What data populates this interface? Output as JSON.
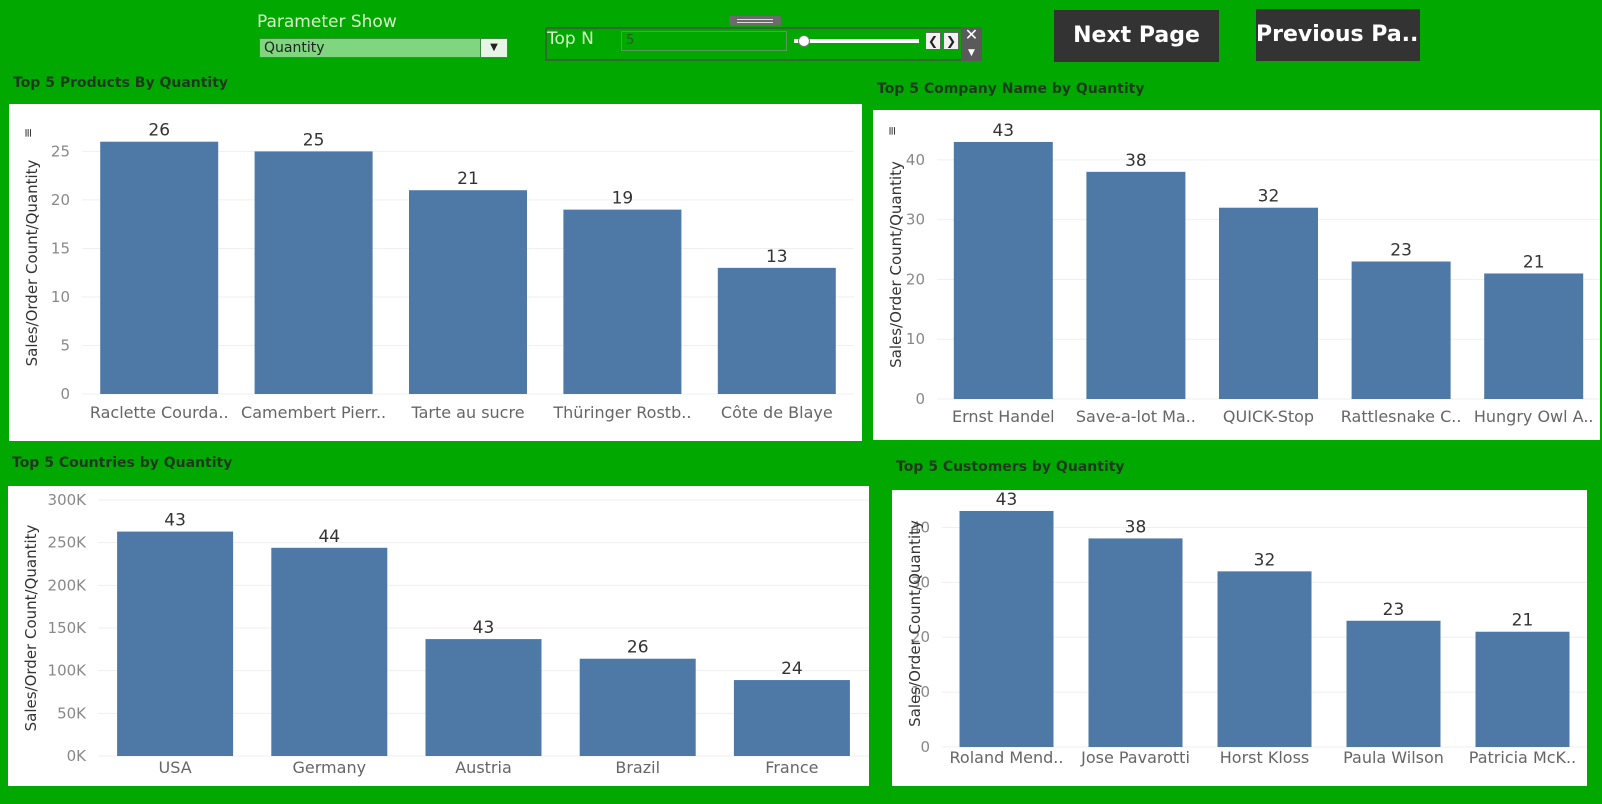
{
  "controls": {
    "parameter_show": {
      "label": "Parameter Show",
      "value": "Quantity"
    },
    "top_n": {
      "label": "Top N",
      "value": "5"
    },
    "next_button": "Next Page",
    "previous_button": "Previous Pa..."
  },
  "colors": {
    "background": "#00a800",
    "bar": "#4e79a7",
    "button": "#333333"
  },
  "chart_data": [
    {
      "type": "bar",
      "title": "Top 5 Products By Quantity",
      "ylabel": "Sales/Order Count/Quantity",
      "categories": [
        "Raclette Courda..",
        "Camembert Pierr..",
        "Tarte au sucre",
        "Thüringer Rostb..",
        "Côte de Blaye"
      ],
      "values": [
        26,
        25,
        21,
        19,
        13
      ],
      "labels": [
        "26",
        "25",
        "21",
        "19",
        "13"
      ],
      "yticks": [
        0,
        5,
        10,
        15,
        20,
        25
      ],
      "ytick_labels": [
        "0",
        "5",
        "10",
        "15",
        "20",
        "25"
      ],
      "ylim": [
        0,
        27
      ]
    },
    {
      "type": "bar",
      "title": "Top 5 Company Name by Quantity",
      "ylabel": "Sales/Order Count/Quantity",
      "categories": [
        "Ernst Handel",
        "Save-a-lot Ma..",
        "QUICK-Stop",
        "Rattlesnake C..",
        "Hungry Owl A.."
      ],
      "values": [
        43,
        38,
        32,
        23,
        21
      ],
      "labels": [
        "43",
        "38",
        "32",
        "23",
        "21"
      ],
      "yticks": [
        0,
        10,
        20,
        30,
        40
      ],
      "ytick_labels": [
        "0",
        "10",
        "20",
        "30",
        "40"
      ],
      "ylim": [
        0,
        45
      ]
    },
    {
      "type": "bar",
      "title": "Top 5 Countries by  Quantity",
      "ylabel": "Sales/Order Count/Quantity",
      "categories": [
        "USA",
        "Germany",
        "Austria",
        "Brazil",
        "France"
      ],
      "values": [
        263000,
        244000,
        137000,
        114000,
        89000
      ],
      "labels": [
        "43",
        "44",
        "43",
        "26",
        "24"
      ],
      "yticks": [
        0,
        50000,
        100000,
        150000,
        200000,
        250000,
        300000
      ],
      "ytick_labels": [
        "0K",
        "50K",
        "100K",
        "150K",
        "200K",
        "250K",
        "300K"
      ],
      "ylim": [
        0,
        300000
      ]
    },
    {
      "type": "bar",
      "title": "Top 5 Customers by Quantity",
      "ylabel": "Sales/Order Count/Quantity",
      "categories": [
        "Roland Mend..",
        "Jose Pavarotti",
        "Horst Kloss",
        "Paula Wilson",
        "Patricia McK.."
      ],
      "values": [
        43,
        38,
        32,
        23,
        21
      ],
      "labels": [
        "43",
        "38",
        "32",
        "23",
        "21"
      ],
      "yticks": [
        0,
        10,
        20,
        30,
        40
      ],
      "ytick_labels": [
        "0",
        "10",
        "20",
        "30",
        "40"
      ],
      "ylim": [
        0,
        45
      ]
    }
  ]
}
